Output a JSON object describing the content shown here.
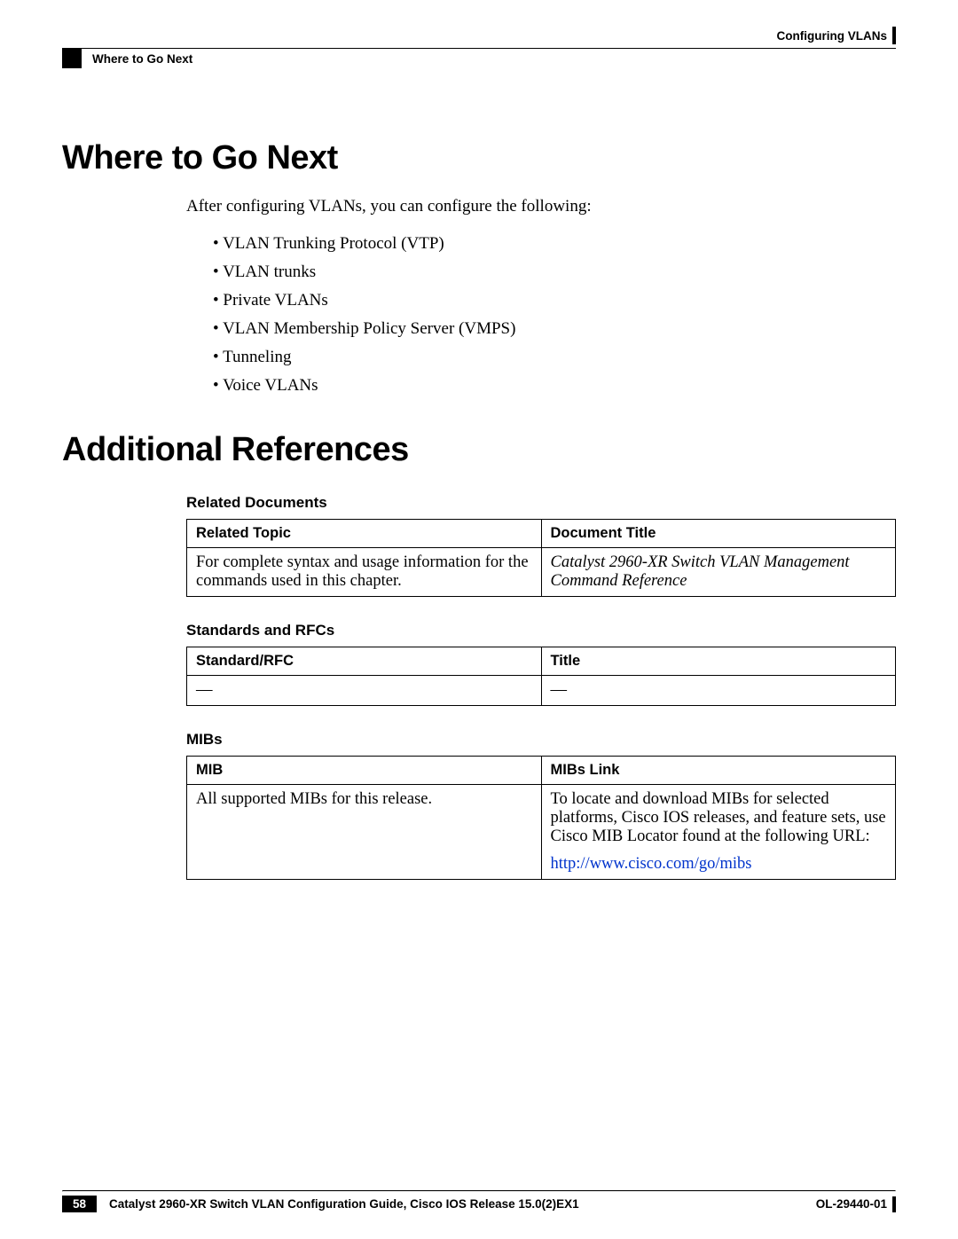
{
  "header": {
    "chapter": "Configuring VLANs",
    "breadcrumb": "Where to Go Next"
  },
  "section1": {
    "heading": "Where to Go Next",
    "intro": "After configuring VLANs, you can configure the following:",
    "bullets": [
      "VLAN Trunking Protocol (VTP)",
      "VLAN trunks",
      "Private VLANs",
      "VLAN Membership Policy Server (VMPS)",
      "Tunneling",
      "Voice VLANs"
    ]
  },
  "section2": {
    "heading": "Additional References",
    "related_docs": {
      "label": "Related Documents",
      "col1": "Related Topic",
      "col2": "Document Title",
      "row1_topic": "For complete syntax and usage information for the commands used in this chapter.",
      "row1_title": "Catalyst 2960-XR Switch VLAN Management Command Reference"
    },
    "standards": {
      "label": "Standards and RFCs",
      "col1": "Standard/RFC",
      "col2": "Title",
      "row1_c1": "—",
      "row1_c2": "—"
    },
    "mibs": {
      "label": "MIBs",
      "col1": "MIB",
      "col2": "MIBs Link",
      "row1_c1": "All supported MIBs for this release.",
      "row1_c2": "To locate and download MIBs for selected platforms, Cisco IOS releases, and feature sets, use Cisco MIB Locator found at the following URL:",
      "row1_link": "http://www.cisco.com/go/mibs"
    }
  },
  "footer": {
    "page_num": "58",
    "title": "Catalyst 2960-XR Switch VLAN Configuration Guide, Cisco IOS Release 15.0(2)EX1",
    "doc_id": "OL-29440-01"
  }
}
